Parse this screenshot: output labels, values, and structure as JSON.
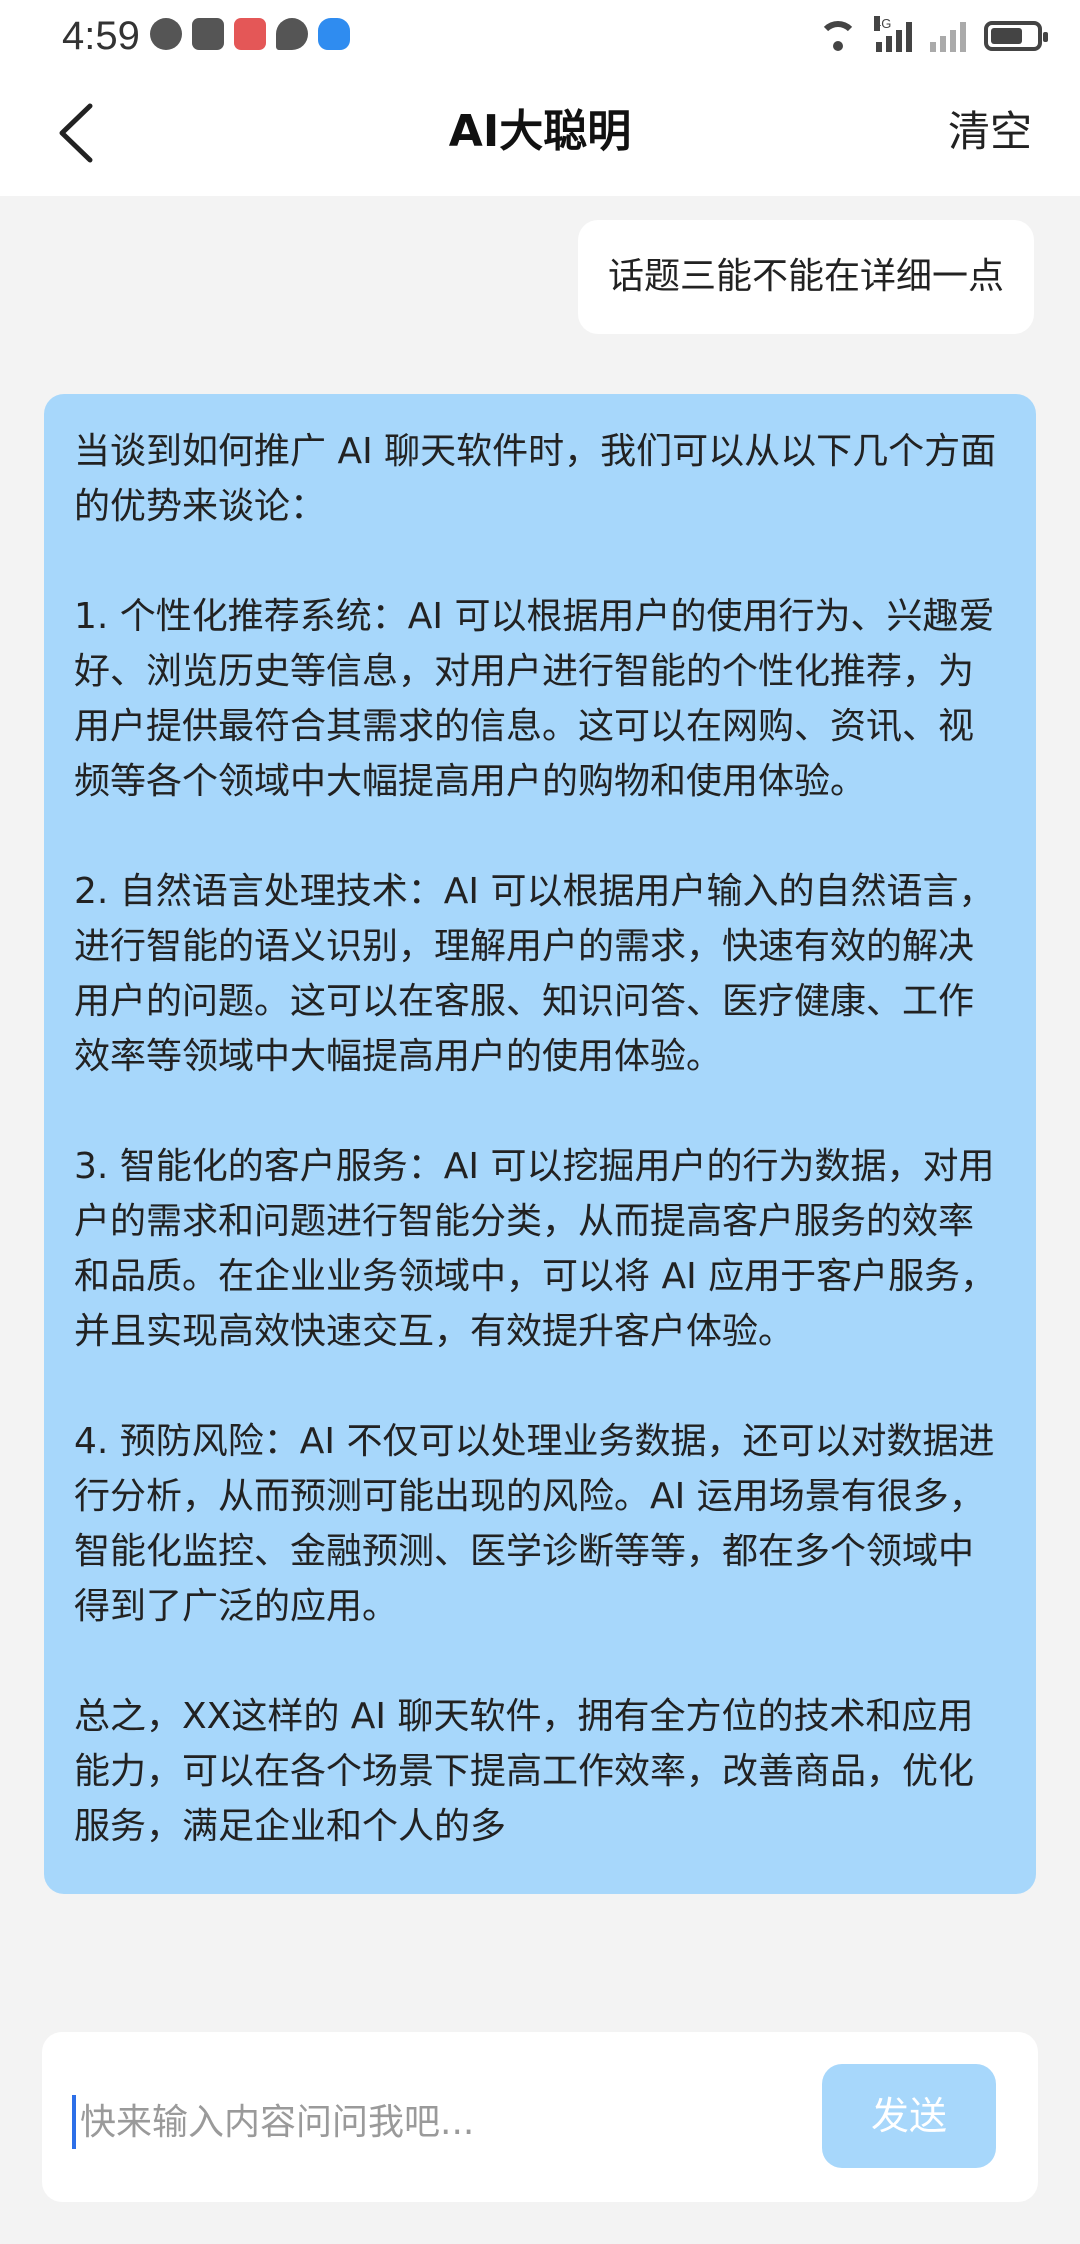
{
  "status_bar": {
    "time": "4:59",
    "network_label": "4G",
    "battery_level": 0.7
  },
  "header": {
    "title": "AI大聪明",
    "clear_label": "清空",
    "back_icon": "chevron-left-icon"
  },
  "chat": {
    "messages": [
      {
        "role": "user",
        "text": "话题三能不能在详细一点"
      },
      {
        "role": "assistant",
        "text": "当谈到如何推广 AI 聊天软件时，我们可以从以下几个方面的优势来谈论：\n\n1. 个性化推荐系统：AI 可以根据用户的使用行为、兴趣爱好、浏览历史等信息，对用户进行智能的个性化推荐，为用户提供最符合其需求的信息。这可以在网购、资讯、视频等各个领域中大幅提高用户的购物和使用体验。\n\n2. 自然语言处理技术：AI 可以根据用户输入的自然语言，进行智能的语义识别，理解用户的需求，快速有效的解决用户的问题。这可以在客服、知识问答、医疗健康、工作效率等领域中大幅提高用户的使用体验。\n\n3. 智能化的客户服务：AI 可以挖掘用户的行为数据，对用户的需求和问题进行智能分类，从而提高客户服务的效率和品质。在企业业务领域中，可以将 AI 应用于客户服务，并且实现高效快速交互，有效提升客户体验。\n\n4. 预防风险：AI 不仅可以处理业务数据，还可以对数据进行分析，从而预测可能出现的风险。AI 运用场景有很多，智能化监控、金融预测、医学诊断等等，都在多个领域中得到了广泛的应用。\n\n总之，XX这样的 AI 聊天软件，拥有全方位的技术和应用能力，可以在各个场景下提高工作效率，改善商品，优化服务，满足企业和个人的多"
      }
    ]
  },
  "input": {
    "placeholder": "快来输入内容问问我吧...",
    "value": "",
    "send_label": "发送"
  },
  "colors": {
    "accent": "#a7d7fb",
    "background": "#f3f3f3",
    "surface": "#ffffff",
    "cursor": "#2d6fe8"
  }
}
